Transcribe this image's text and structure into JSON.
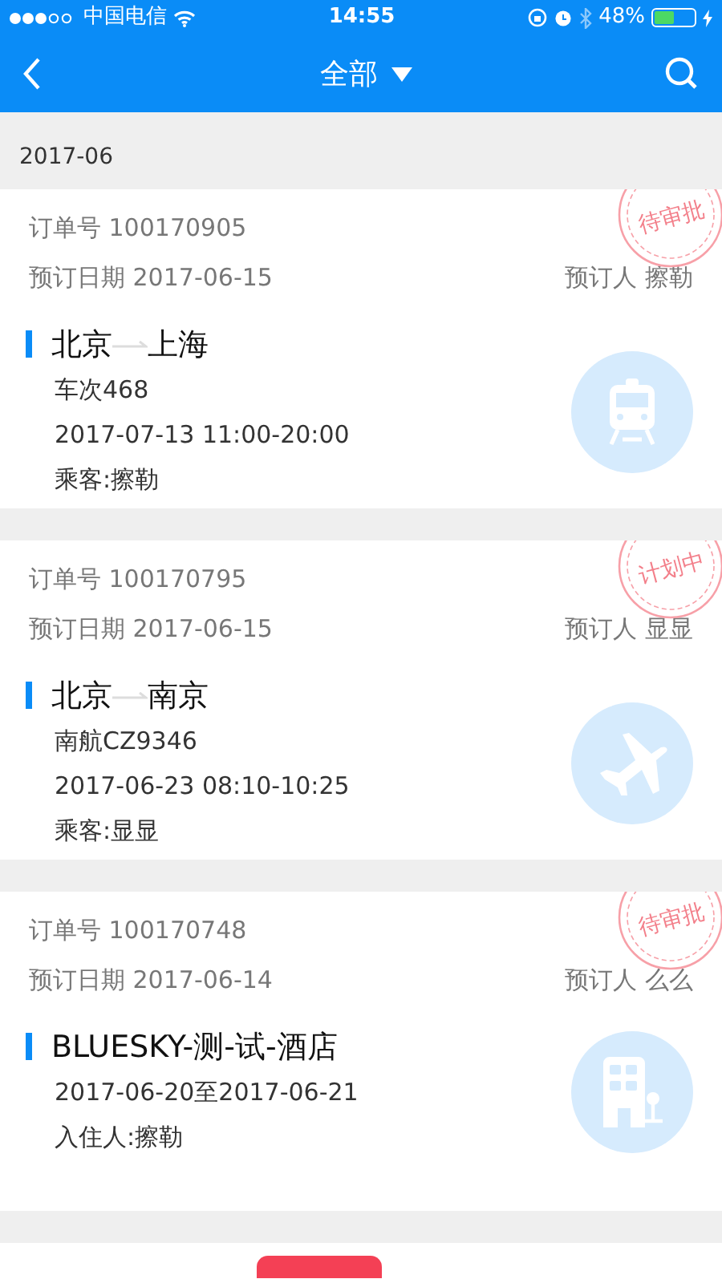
{
  "status_bar": {
    "carrier": "中国电信",
    "time": "14:55",
    "battery": "48%"
  },
  "nav": {
    "title": "全部"
  },
  "section": {
    "label": "2017-06"
  },
  "orders": [
    {
      "kind": "train",
      "order_no": "订单号 100170905",
      "date": "预订日期 2017-06-15",
      "booker": "预订人 擦勒",
      "stamp": "待审批",
      "from": "北京",
      "to": "上海",
      "lines": [
        "车次468",
        "2017-07-13  11:00-20:00",
        "乘客:擦勒"
      ]
    },
    {
      "kind": "flight",
      "order_no": "订单号 100170795",
      "date": "预订日期 2017-06-15",
      "booker": "预订人 显显",
      "stamp": "计划中",
      "from": "北京",
      "to": "南京",
      "lines": [
        "南航CZ9346",
        "2017-06-23  08:10-10:25",
        "乘客:显显"
      ]
    },
    {
      "kind": "hotel",
      "order_no": "订单号 100170748",
      "date": "预订日期 2017-06-14",
      "booker": "预订人 么么",
      "stamp": "待审批",
      "name": "BLUESKY-测-试-酒店",
      "lines": [
        "2017-06-20至2017-06-21",
        "入住人:擦勒"
      ]
    }
  ]
}
